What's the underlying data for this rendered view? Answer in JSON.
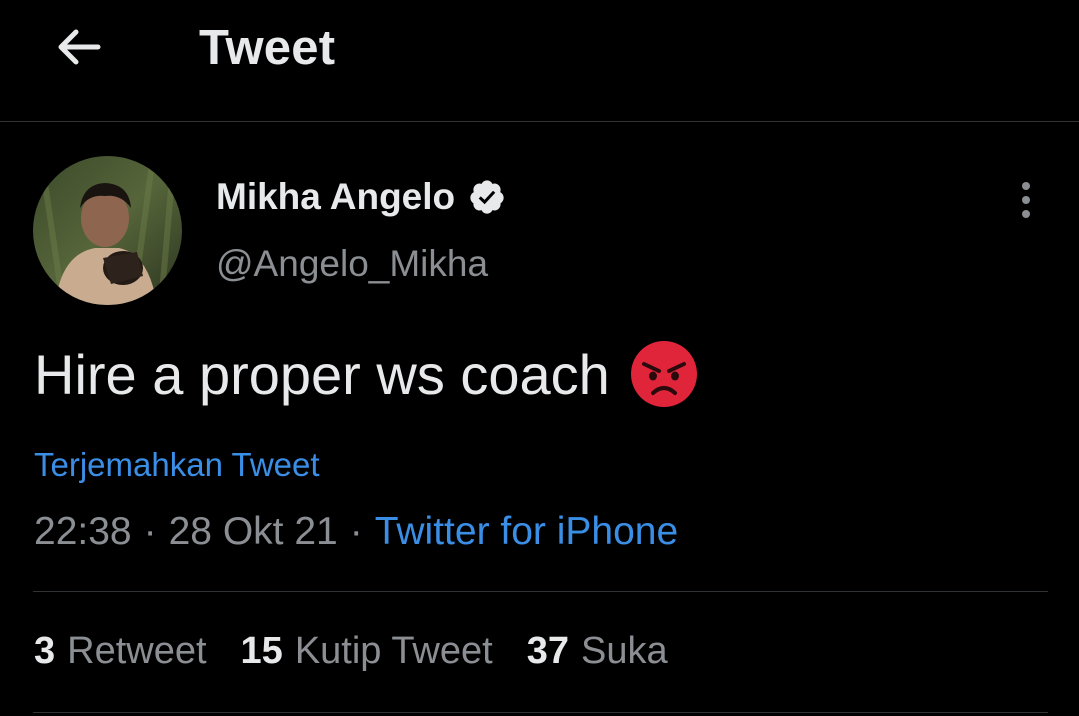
{
  "header": {
    "title": "Tweet",
    "back_icon": "arrow-left-icon"
  },
  "author": {
    "name": "Mikha Angelo",
    "handle": "@Angelo_Mikha",
    "verified_icon": "verified-badge-icon"
  },
  "tweet": {
    "text": "Hire a proper ws coach",
    "emoji": "angry-face-icon",
    "translate_label": "Terjemahkan Tweet",
    "time": "22:38",
    "separator": "·",
    "date": "28 Okt 21",
    "source": "Twitter for iPhone"
  },
  "stats": {
    "retweets": {
      "count": "3",
      "label": "Retweet"
    },
    "quotes": {
      "count": "15",
      "label": "Kutip Tweet"
    },
    "likes": {
      "count": "37",
      "label": "Suka"
    }
  },
  "colors": {
    "background": "#000000",
    "text": "#e7e9ea",
    "secondary": "#8b8f93",
    "link": "#3a8ee6",
    "divider": "#2f3336",
    "emoji": "#e0243a"
  }
}
